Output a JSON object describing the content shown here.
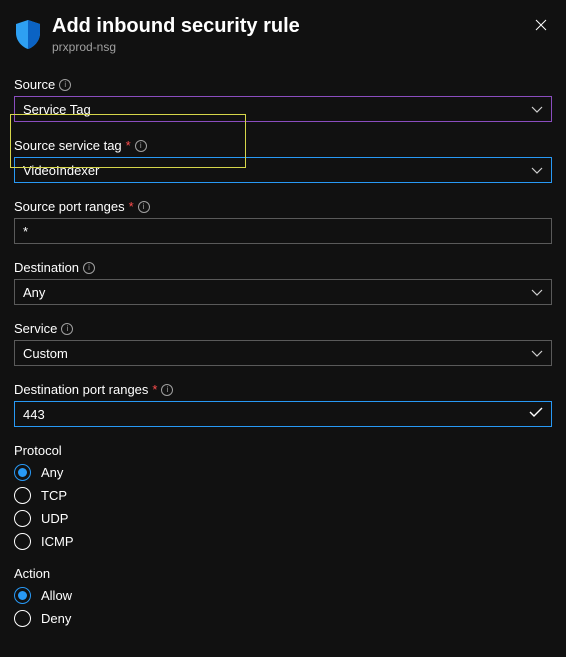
{
  "header": {
    "title": "Add inbound security rule",
    "subtitle": "prxprod-nsg"
  },
  "fields": {
    "source": {
      "label": "Source",
      "value": "Service Tag"
    },
    "source_service_tag": {
      "label": "Source service tag",
      "value": "VideoIndexer"
    },
    "source_port_ranges": {
      "label": "Source port ranges",
      "value": "*"
    },
    "destination": {
      "label": "Destination",
      "value": "Any"
    },
    "service": {
      "label": "Service",
      "value": "Custom"
    },
    "destination_port_ranges": {
      "label": "Destination port ranges",
      "value": "443"
    }
  },
  "protocol": {
    "heading": "Protocol",
    "options": [
      "Any",
      "TCP",
      "UDP",
      "ICMP"
    ],
    "selected": "Any"
  },
  "action": {
    "heading": "Action",
    "options": [
      "Allow",
      "Deny"
    ],
    "selected": "Allow"
  }
}
